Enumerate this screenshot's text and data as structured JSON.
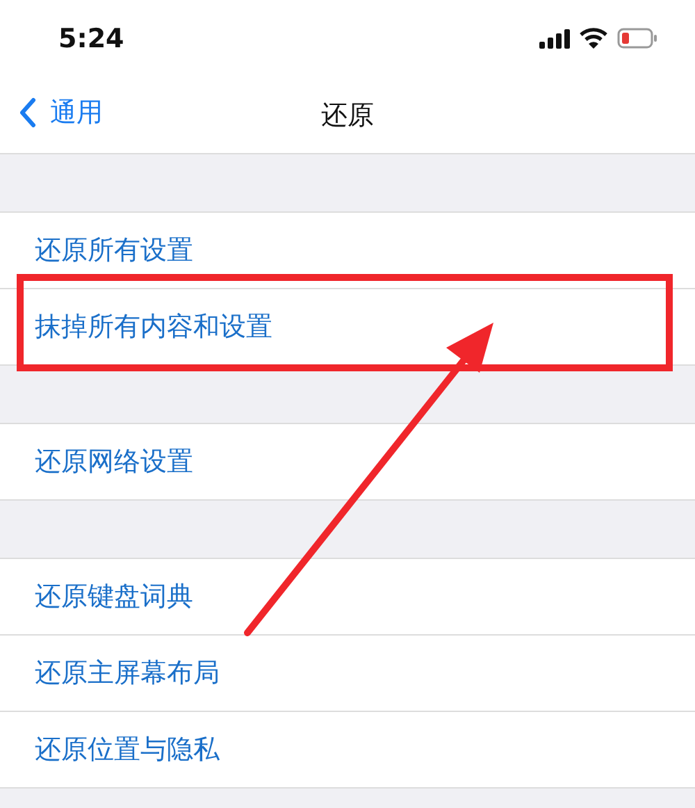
{
  "status_bar": {
    "time": "5:24"
  },
  "nav": {
    "back": "通用",
    "title": "还原"
  },
  "groups": [
    {
      "rows": [
        {
          "label": "还原所有设置",
          "highlighted": false
        },
        {
          "label": "抹掉所有内容和设置",
          "highlighted": true
        }
      ]
    },
    {
      "rows": [
        {
          "label": "还原网络设置",
          "highlighted": false
        }
      ]
    },
    {
      "rows": [
        {
          "label": "还原键盘词典",
          "highlighted": false
        },
        {
          "label": "还原主屏幕布局",
          "highlighted": false
        },
        {
          "label": "还原位置与隐私",
          "highlighted": false
        }
      ]
    }
  ]
}
